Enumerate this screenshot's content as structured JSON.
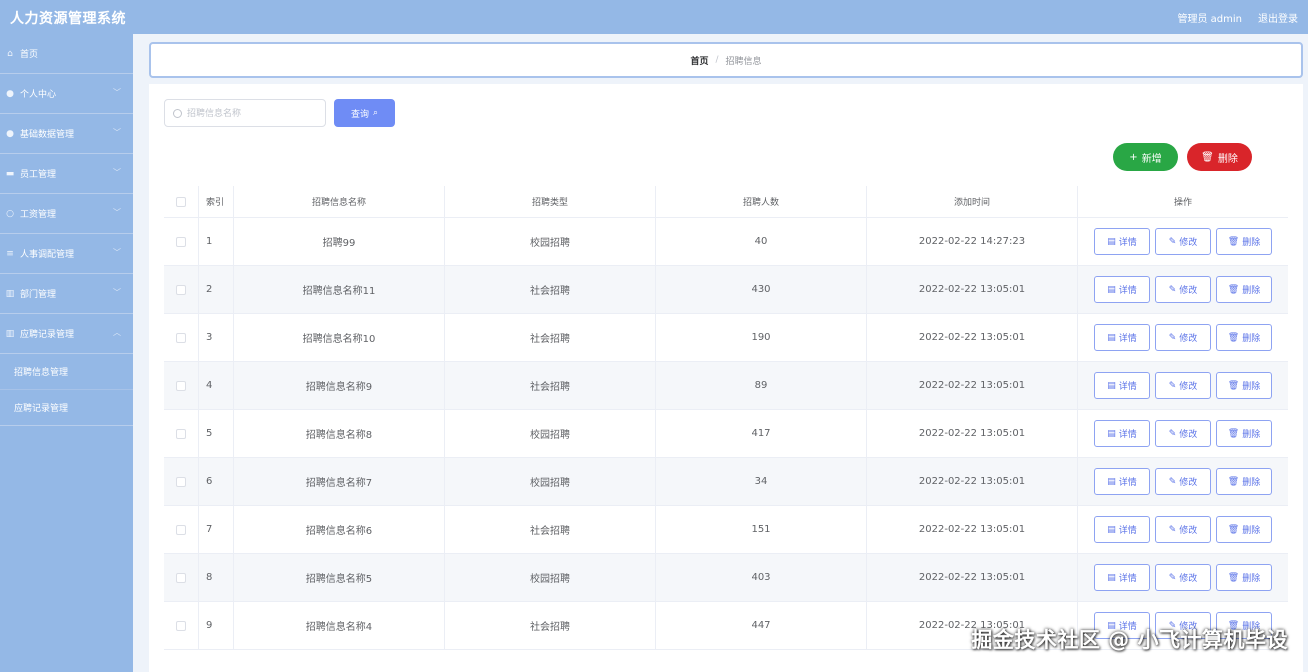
{
  "app": {
    "title": "人力资源管理系统"
  },
  "topbar": {
    "user": "管理员 admin",
    "logout": "退出登录"
  },
  "sidebar": {
    "items": [
      {
        "label": "首页",
        "icon": "home-icon"
      },
      {
        "label": "个人中心",
        "icon": "user-icon"
      },
      {
        "label": "基础数据管理",
        "icon": "user-icon"
      },
      {
        "label": "员工管理",
        "icon": "car-icon"
      },
      {
        "label": "工资管理",
        "icon": "circle-icon"
      },
      {
        "label": "人事调配管理",
        "icon": "list-icon"
      },
      {
        "label": "部门管理",
        "icon": "chart-icon"
      },
      {
        "label": "应聘记录管理",
        "icon": "chart-icon"
      }
    ],
    "subitems": [
      {
        "label": "招聘信息管理"
      },
      {
        "label": "应聘记录管理"
      }
    ]
  },
  "breadcrumb": {
    "home": "首页",
    "separator": "/",
    "current": "招聘信息"
  },
  "search": {
    "placeholder": "招聘信息名称",
    "button": "查询"
  },
  "actions": {
    "add": "新增",
    "delete": "删除"
  },
  "table": {
    "headers": [
      "索引",
      "招聘信息名称",
      "招聘类型",
      "招聘人数",
      "添加时间",
      "操作"
    ],
    "op_labels": {
      "detail": "详情",
      "edit": "修改",
      "delete": "删除"
    },
    "rows": [
      {
        "index": "1",
        "name": "招聘99",
        "type": "校园招聘",
        "count": "40",
        "time": "2022-02-22 14:27:23"
      },
      {
        "index": "2",
        "name": "招聘信息名称11",
        "type": "社会招聘",
        "count": "430",
        "time": "2022-02-22 13:05:01"
      },
      {
        "index": "3",
        "name": "招聘信息名称10",
        "type": "社会招聘",
        "count": "190",
        "time": "2022-02-22 13:05:01"
      },
      {
        "index": "4",
        "name": "招聘信息名称9",
        "type": "社会招聘",
        "count": "89",
        "time": "2022-02-22 13:05:01"
      },
      {
        "index": "5",
        "name": "招聘信息名称8",
        "type": "校园招聘",
        "count": "417",
        "time": "2022-02-22 13:05:01"
      },
      {
        "index": "6",
        "name": "招聘信息名称7",
        "type": "校园招聘",
        "count": "34",
        "time": "2022-02-22 13:05:01"
      },
      {
        "index": "7",
        "name": "招聘信息名称6",
        "type": "社会招聘",
        "count": "151",
        "time": "2022-02-22 13:05:01"
      },
      {
        "index": "8",
        "name": "招聘信息名称5",
        "type": "校园招聘",
        "count": "403",
        "time": "2022-02-22 13:05:01"
      },
      {
        "index": "9",
        "name": "招聘信息名称4",
        "type": "社会招聘",
        "count": "447",
        "time": "2022-02-22 13:05:01"
      }
    ]
  },
  "watermark": "掘金技术社区 @ 小飞计算机毕设",
  "colors": {
    "sidebar": "#94b8e6",
    "primary": "#6f8cf5",
    "success": "#29a745",
    "danger": "#d9252a"
  }
}
